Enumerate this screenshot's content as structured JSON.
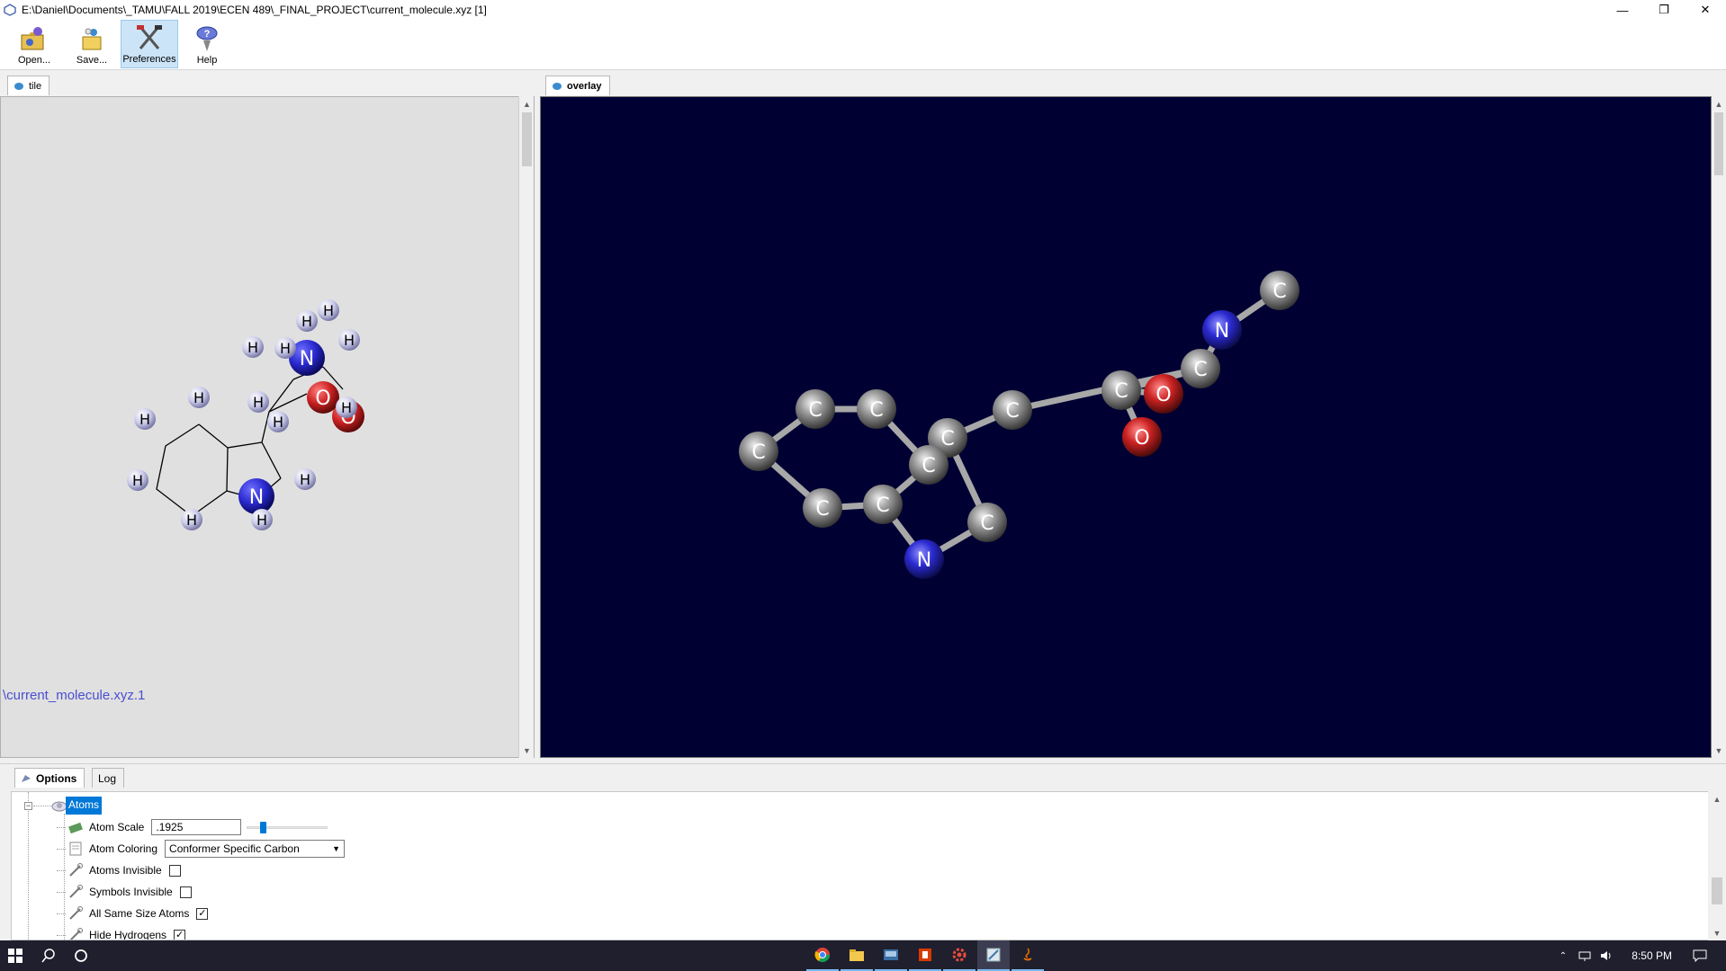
{
  "window": {
    "title": "E:\\Daniel\\Documents\\_TAMU\\FALL 2019\\ECEN 489\\_FINAL_PROJECT\\current_molecule.xyz [1]",
    "minimize_glyph": "—",
    "restore_glyph": "❐",
    "close_glyph": "✕"
  },
  "toolbar": {
    "items": [
      {
        "label": "Open...",
        "icon": "open-icon"
      },
      {
        "label": "Save...",
        "icon": "save-icon"
      },
      {
        "label": "Preferences",
        "icon": "preferences-icon",
        "active": true
      },
      {
        "label": "Help",
        "icon": "help-icon"
      }
    ]
  },
  "left_tab": {
    "label": "tile"
  },
  "right_tab": {
    "label": "overlay"
  },
  "left_view": {
    "molecule_label": "\\current_molecule.xyz.1",
    "atoms": [
      {
        "sym": "H",
        "el": "H"
      },
      {
        "sym": "H",
        "el": "H"
      },
      {
        "sym": "H",
        "el": "H"
      },
      {
        "sym": "H",
        "el": "H"
      },
      {
        "sym": "N",
        "el": "N"
      },
      {
        "sym": "H",
        "el": "H"
      },
      {
        "sym": "O",
        "el": "O"
      },
      {
        "sym": "H",
        "el": "H"
      },
      {
        "sym": "H",
        "el": "H"
      },
      {
        "sym": "H",
        "el": "H"
      },
      {
        "sym": "H",
        "el": "H"
      },
      {
        "sym": "H",
        "el": "H"
      },
      {
        "sym": "H",
        "el": "H"
      },
      {
        "sym": "N",
        "el": "N"
      },
      {
        "sym": "H",
        "el": "H"
      },
      {
        "sym": "H",
        "el": "H"
      },
      {
        "sym": "H",
        "el": "H"
      },
      {
        "sym": "O",
        "el": "O"
      }
    ]
  },
  "right_view": {
    "atoms": [
      {
        "sym": "C",
        "el": "C"
      },
      {
        "sym": "N",
        "el": "N"
      },
      {
        "sym": "C",
        "el": "C"
      },
      {
        "sym": "C",
        "el": "C"
      },
      {
        "sym": "O",
        "el": "O"
      },
      {
        "sym": "O",
        "el": "O"
      },
      {
        "sym": "C",
        "el": "C"
      },
      {
        "sym": "C",
        "el": "C"
      },
      {
        "sym": "C",
        "el": "C"
      },
      {
        "sym": "C",
        "el": "C"
      },
      {
        "sym": "C",
        "el": "C"
      },
      {
        "sym": "C",
        "el": "C"
      },
      {
        "sym": "C",
        "el": "C"
      },
      {
        "sym": "C",
        "el": "C"
      },
      {
        "sym": "C",
        "el": "C"
      },
      {
        "sym": "N",
        "el": "N"
      }
    ]
  },
  "colors": {
    "carbon": "#8a8a8a",
    "nitrogen": "#2a2ad0",
    "oxygen": "#cc2222",
    "hydrogen": "#d8d8ee",
    "viewport_bg": "#000033",
    "selection": "#0078d7",
    "link_text": "#4a4fd0"
  },
  "bottom_tabs": [
    {
      "label": "Options",
      "active": true
    },
    {
      "label": "Log",
      "active": false
    }
  ],
  "options": {
    "root": "Atoms",
    "expander": "−",
    "rows": [
      {
        "label": "Atom Scale",
        "type": "slider",
        "value": ".1925",
        "level": 0.18
      },
      {
        "label": "Atom Coloring",
        "type": "dropdown",
        "value": "Conformer Specific Carbon"
      },
      {
        "label": "Atoms Invisible",
        "type": "checkbox",
        "checked": false
      },
      {
        "label": "Symbols Invisible",
        "type": "checkbox",
        "checked": false
      },
      {
        "label": "All Same Size Atoms",
        "type": "checkbox",
        "checked": true
      },
      {
        "label": "Hide Hydrogens",
        "type": "checkbox",
        "checked": true
      }
    ]
  },
  "taskbar": {
    "time": "8:50 PM",
    "apps": [
      "chrome-icon",
      "file-explorer-icon",
      "app-icon",
      "office-icon",
      "settings-icon",
      "molecule-app-icon",
      "java-icon"
    ]
  }
}
